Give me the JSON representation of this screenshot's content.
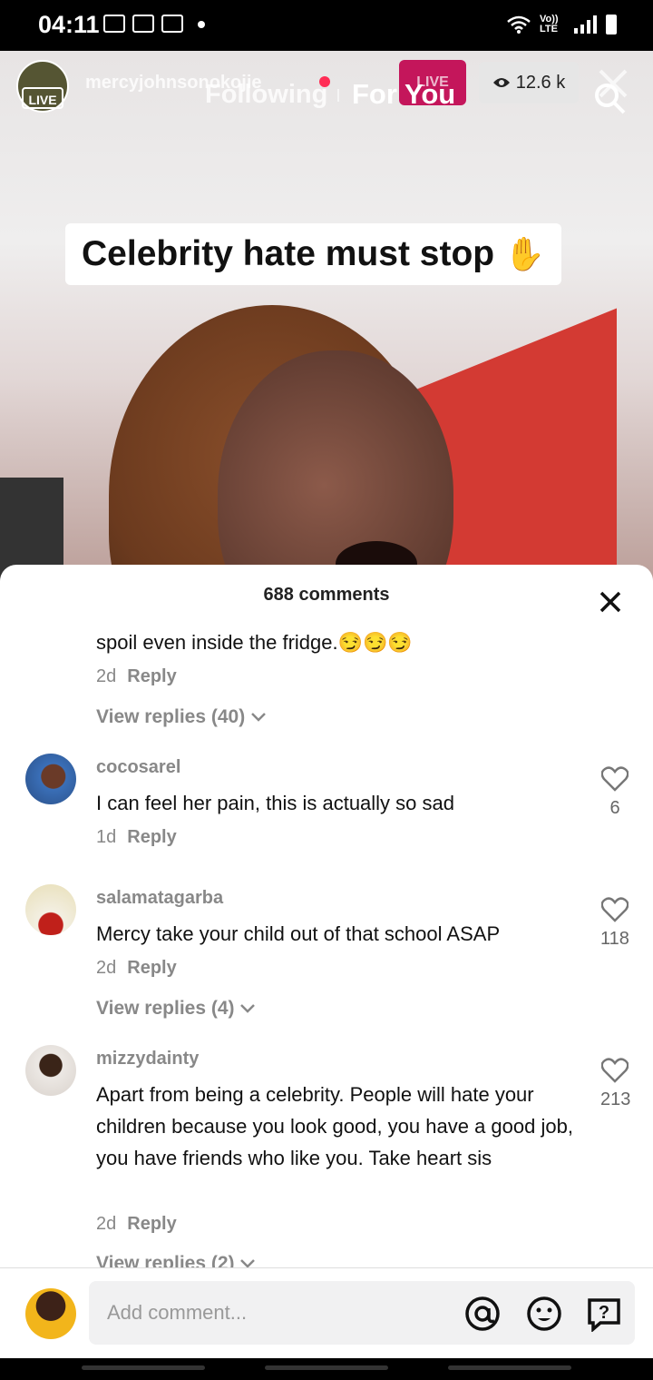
{
  "status_bar": {
    "time": "04:11",
    "lte_label": "Vo)) LTE"
  },
  "live_header": {
    "live_label": "LIVE",
    "username": "mercyjohnsonokojie",
    "tab_following": "Following",
    "tab_for_you": "For You",
    "live_pill": "LIVE",
    "viewer_count": "12.6 k"
  },
  "video": {
    "caption": "Celebrity hate must stop",
    "caption_emoji": "✋"
  },
  "comments_sheet": {
    "title": "688 comments",
    "partial_comment": {
      "text": "spoil even inside the fridge.😏😏😏",
      "time": "2d",
      "reply_label": "Reply",
      "view_replies": "View replies (40)"
    },
    "comments": [
      {
        "username": "cocosarel",
        "text": "I can feel her pain, this is actually so sad",
        "time": "1d",
        "reply_label": "Reply",
        "likes": "6"
      },
      {
        "username": "salamatagarba",
        "text": "Mercy take your child out of that school ASAP",
        "time": "2d",
        "reply_label": "Reply",
        "likes": "118",
        "view_replies": "View replies (4)"
      },
      {
        "username": "mizzydainty",
        "text": "Apart from being a celebrity. People will hate your children because you look good, you have a good job, you have friends who like you. Take heart sis",
        "time": "2d",
        "reply_label": "Reply",
        "likes": "213",
        "view_replies": "View replies (2)"
      }
    ]
  },
  "composer": {
    "placeholder": "Add comment..."
  },
  "colors": {
    "live_pink": "#c4165b",
    "notify_red": "#ff2d55",
    "caption_bg": "#ffffff"
  }
}
